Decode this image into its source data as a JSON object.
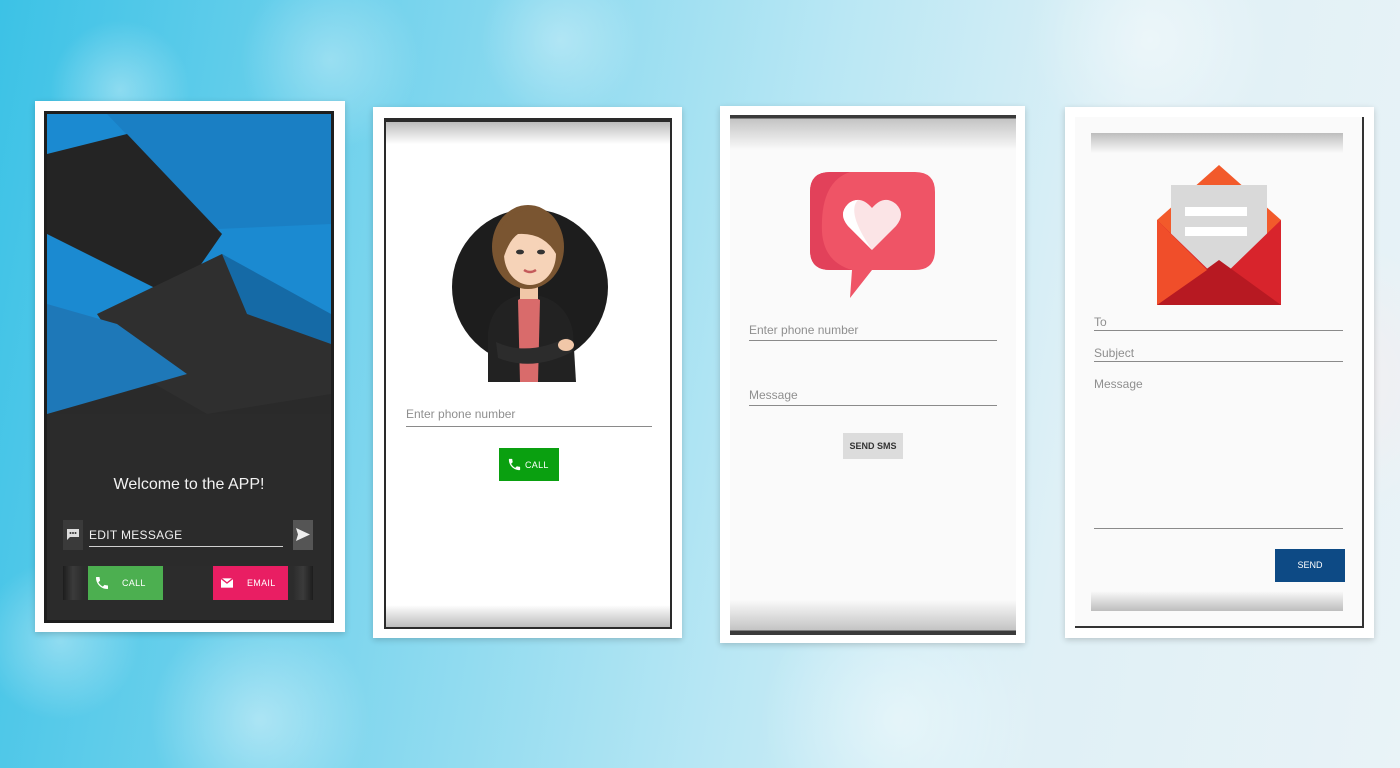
{
  "screen1": {
    "welcome": "Welcome to the APP!",
    "input_label": "EDIT MESSAGE",
    "call_label": "CALL",
    "email_label": "EMAIL",
    "colors": {
      "call": "#4caf50",
      "email": "#e91e63",
      "art_blue": "#1b8ad1"
    },
    "icons": [
      "message-icon",
      "send-icon",
      "phone-icon",
      "email-icon"
    ]
  },
  "screen2": {
    "phone_placeholder": "Enter phone number",
    "call_label": "CALL",
    "colors": {
      "call": "#0aa010"
    },
    "icons": [
      "woman-avatar-illustration",
      "phone-icon"
    ]
  },
  "screen3": {
    "phone_placeholder": "Enter phone number",
    "message_placeholder": "Message",
    "send_label": "SEND SMS",
    "colors": {
      "heart_bubble": "#ef5466"
    },
    "icons": [
      "heart-chat-bubble-icon"
    ]
  },
  "screen4": {
    "to_placeholder": "To",
    "subject_placeholder": "Subject",
    "message_placeholder": "Message",
    "send_label": "SEND",
    "colors": {
      "send": "#0d4a85",
      "envelope": "#e8302f"
    },
    "icons": [
      "open-envelope-icon"
    ]
  }
}
